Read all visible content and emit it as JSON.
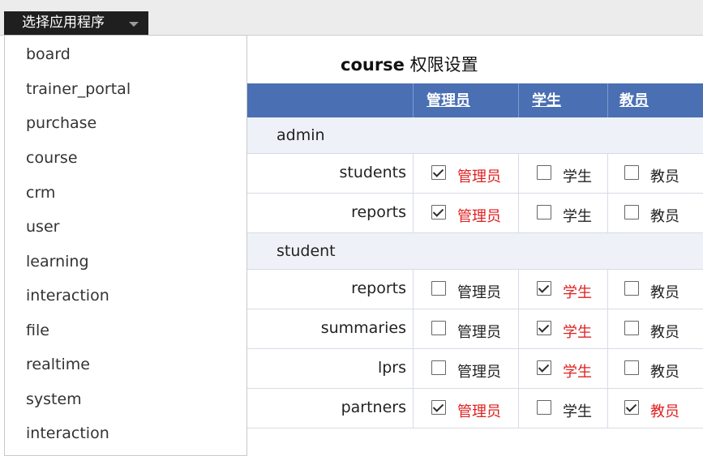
{
  "app_selector": {
    "label": "选择应用程序"
  },
  "apps": [
    "board",
    "trainer_portal",
    "purchase",
    "course",
    "crm",
    "user",
    "learning",
    "interaction",
    "file",
    "realtime",
    "system",
    "interaction"
  ],
  "page": {
    "title_bold": "course",
    "title_rest": " 权限设置"
  },
  "columns": [
    "管理员",
    "学生",
    "教员"
  ],
  "rows": [
    {
      "type": "group",
      "label": "admin"
    },
    {
      "type": "sub",
      "label": "students",
      "perms": [
        true,
        false,
        false
      ]
    },
    {
      "type": "sub",
      "label": "reports",
      "perms": [
        true,
        false,
        false
      ]
    },
    {
      "type": "group",
      "label": "student"
    },
    {
      "type": "sub",
      "label": "reports",
      "perms": [
        false,
        true,
        false
      ]
    },
    {
      "type": "sub",
      "label": "summaries",
      "perms": [
        false,
        true,
        false
      ]
    },
    {
      "type": "sub",
      "label": "lprs",
      "perms": [
        false,
        true,
        false
      ]
    },
    {
      "type": "sub",
      "label": "partners",
      "perms": [
        true,
        false,
        true
      ]
    }
  ],
  "colors": {
    "header_bg": "#4a6fb3",
    "group_bg": "#eef1f8",
    "checked_text": "#e02020"
  }
}
